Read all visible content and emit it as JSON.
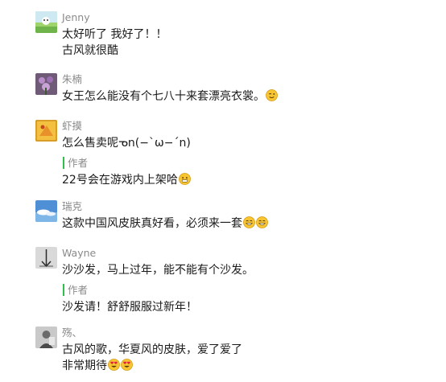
{
  "comments": [
    {
      "name": "Jenny",
      "lines": [
        "太好听了 我好了！！",
        "古风就很酷"
      ]
    },
    {
      "name": "朱楠",
      "lines": [
        "女王怎么能没有个七八十来套漂亮衣裳。"
      ],
      "emoji": [
        "wink-emoji"
      ]
    },
    {
      "name": "虾摸",
      "lines": [
        "怎么售卖呢ᓀn(−`ω−´n)"
      ],
      "reply": {
        "tag": "作者",
        "text": "22号会在游戏内上架哈",
        "emoji": [
          "grin-emoji"
        ]
      }
    },
    {
      "name": "瑞克",
      "lines": [
        "这款中国风皮肤真好看，必须来一套"
      ],
      "emoji": [
        "big-grin-emoji",
        "big-grin-emoji"
      ]
    },
    {
      "name": "Wayne",
      "lines": [
        "沙沙发，马上过年，能不能有个沙发。"
      ],
      "reply": {
        "tag": "作者",
        "text": "沙发请！舒舒服服过新年！"
      }
    },
    {
      "name": "殇、",
      "lines": [
        "古风的歌，华夏风的皮肤，爱了爱了",
        "非常期待"
      ],
      "emoji": [
        "heart-eyes-emoji",
        "heart-eyes-emoji"
      ]
    }
  ]
}
